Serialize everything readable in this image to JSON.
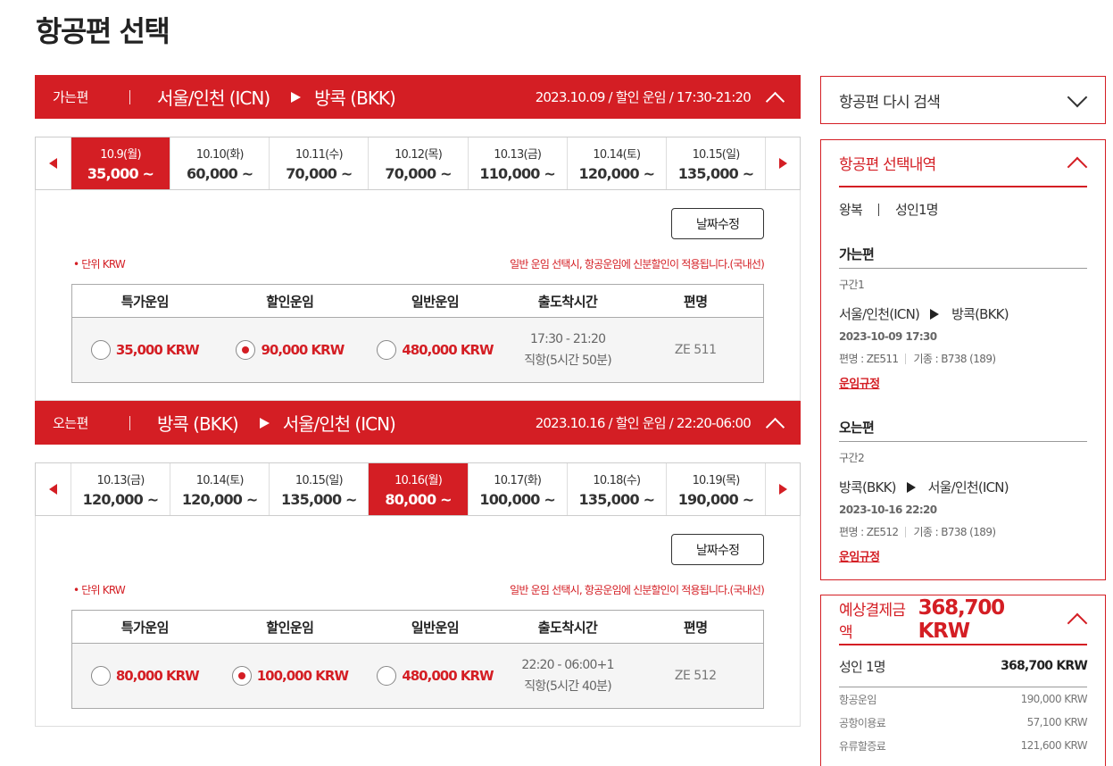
{
  "page_title": "항공편 선택",
  "colors": {
    "accent": "#d41e24"
  },
  "outbound": {
    "dir_label": "가는편",
    "from": "서울/인천 (ICN)",
    "to": "방콕 (BKK)",
    "info": "2023.10.09 / 할인 운임 / 17:30-21:20",
    "dates": [
      {
        "date": "10.9(월)",
        "price": "35,000 ~",
        "active": true
      },
      {
        "date": "10.10(화)",
        "price": "60,000 ~"
      },
      {
        "date": "10.11(수)",
        "price": "70,000 ~"
      },
      {
        "date": "10.12(목)",
        "price": "70,000 ~"
      },
      {
        "date": "10.13(금)",
        "price": "110,000 ~"
      },
      {
        "date": "10.14(토)",
        "price": "120,000 ~"
      },
      {
        "date": "10.15(일)",
        "price": "135,000 ~"
      }
    ],
    "date_edit_label": "날짜수정",
    "unit": "• 단위 KRW",
    "note": "일반 운임 선택시, 항공운임에 신분할인이 적용됩니다.(국내선)",
    "headers": [
      "특가운임",
      "할인운임",
      "일반운임",
      "출도착시간",
      "편명"
    ],
    "fares": [
      "35,000 KRW",
      "90,000 KRW",
      "480,000 KRW"
    ],
    "selected_fare": "할인운임",
    "time": "17:30 - 21:20",
    "duration": "직항(5시간 50분)",
    "flight_no": "ZE 511"
  },
  "inbound": {
    "dir_label": "오는편",
    "from": "방콕 (BKK)",
    "to": "서울/인천 (ICN)",
    "info": "2023.10.16 / 할인 운임 / 22:20-06:00",
    "dates": [
      {
        "date": "10.13(금)",
        "price": "120,000 ~"
      },
      {
        "date": "10.14(토)",
        "price": "120,000 ~"
      },
      {
        "date": "10.15(일)",
        "price": "135,000 ~"
      },
      {
        "date": "10.16(월)",
        "price": "80,000 ~",
        "active": true
      },
      {
        "date": "10.17(화)",
        "price": "100,000 ~"
      },
      {
        "date": "10.18(수)",
        "price": "135,000 ~"
      },
      {
        "date": "10.19(목)",
        "price": "190,000 ~"
      }
    ],
    "date_edit_label": "날짜수정",
    "unit": "• 단위 KRW",
    "note": "일반 운임 선택시, 항공운임에 신분할인이 적용됩니다.(국내선)",
    "headers": [
      "특가운임",
      "할인운임",
      "일반운임",
      "출도착시간",
      "편명"
    ],
    "fares": [
      "80,000 KRW",
      "100,000 KRW",
      "480,000 KRW"
    ],
    "selected_fare": "할인운임",
    "time": "22:20 - 06:00+1",
    "duration": "직항(5시간 40분)",
    "flight_no": "ZE 512"
  },
  "sidebar": {
    "research_label": "항공편 다시 검색",
    "summary": {
      "title": "항공편 선택내역",
      "trip_type": "왕복",
      "passengers": "성인1명",
      "legs": [
        {
          "title": "가는편",
          "segment": "구간1",
          "from": "서울/인천(ICN)",
          "to": "방콕(BKK)",
          "datetime": "2023-10-09 17:30",
          "flight": "편명 : ZE511",
          "aircraft": "기종 : B738 (189)",
          "rule_link": "운임규정"
        },
        {
          "title": "오는편",
          "segment": "구간2",
          "from": "방콕(BKK)",
          "to": "서울/인천(ICN)",
          "datetime": "2023-10-16 22:20",
          "flight": "편명 : ZE512",
          "aircraft": "기종 : B738 (189)",
          "rule_link": "운임규정"
        }
      ]
    },
    "price": {
      "label": "예상결제금액",
      "total": "368,700 KRW",
      "pax_label": "성인 1명",
      "pax_amount": "368,700 KRW",
      "fees": [
        {
          "label": "항공운임",
          "amount": "190,000 KRW"
        },
        {
          "label": "공항이용료",
          "amount": "57,100 KRW"
        },
        {
          "label": "유류할증료",
          "amount": "121,600 KRW"
        }
      ]
    }
  }
}
